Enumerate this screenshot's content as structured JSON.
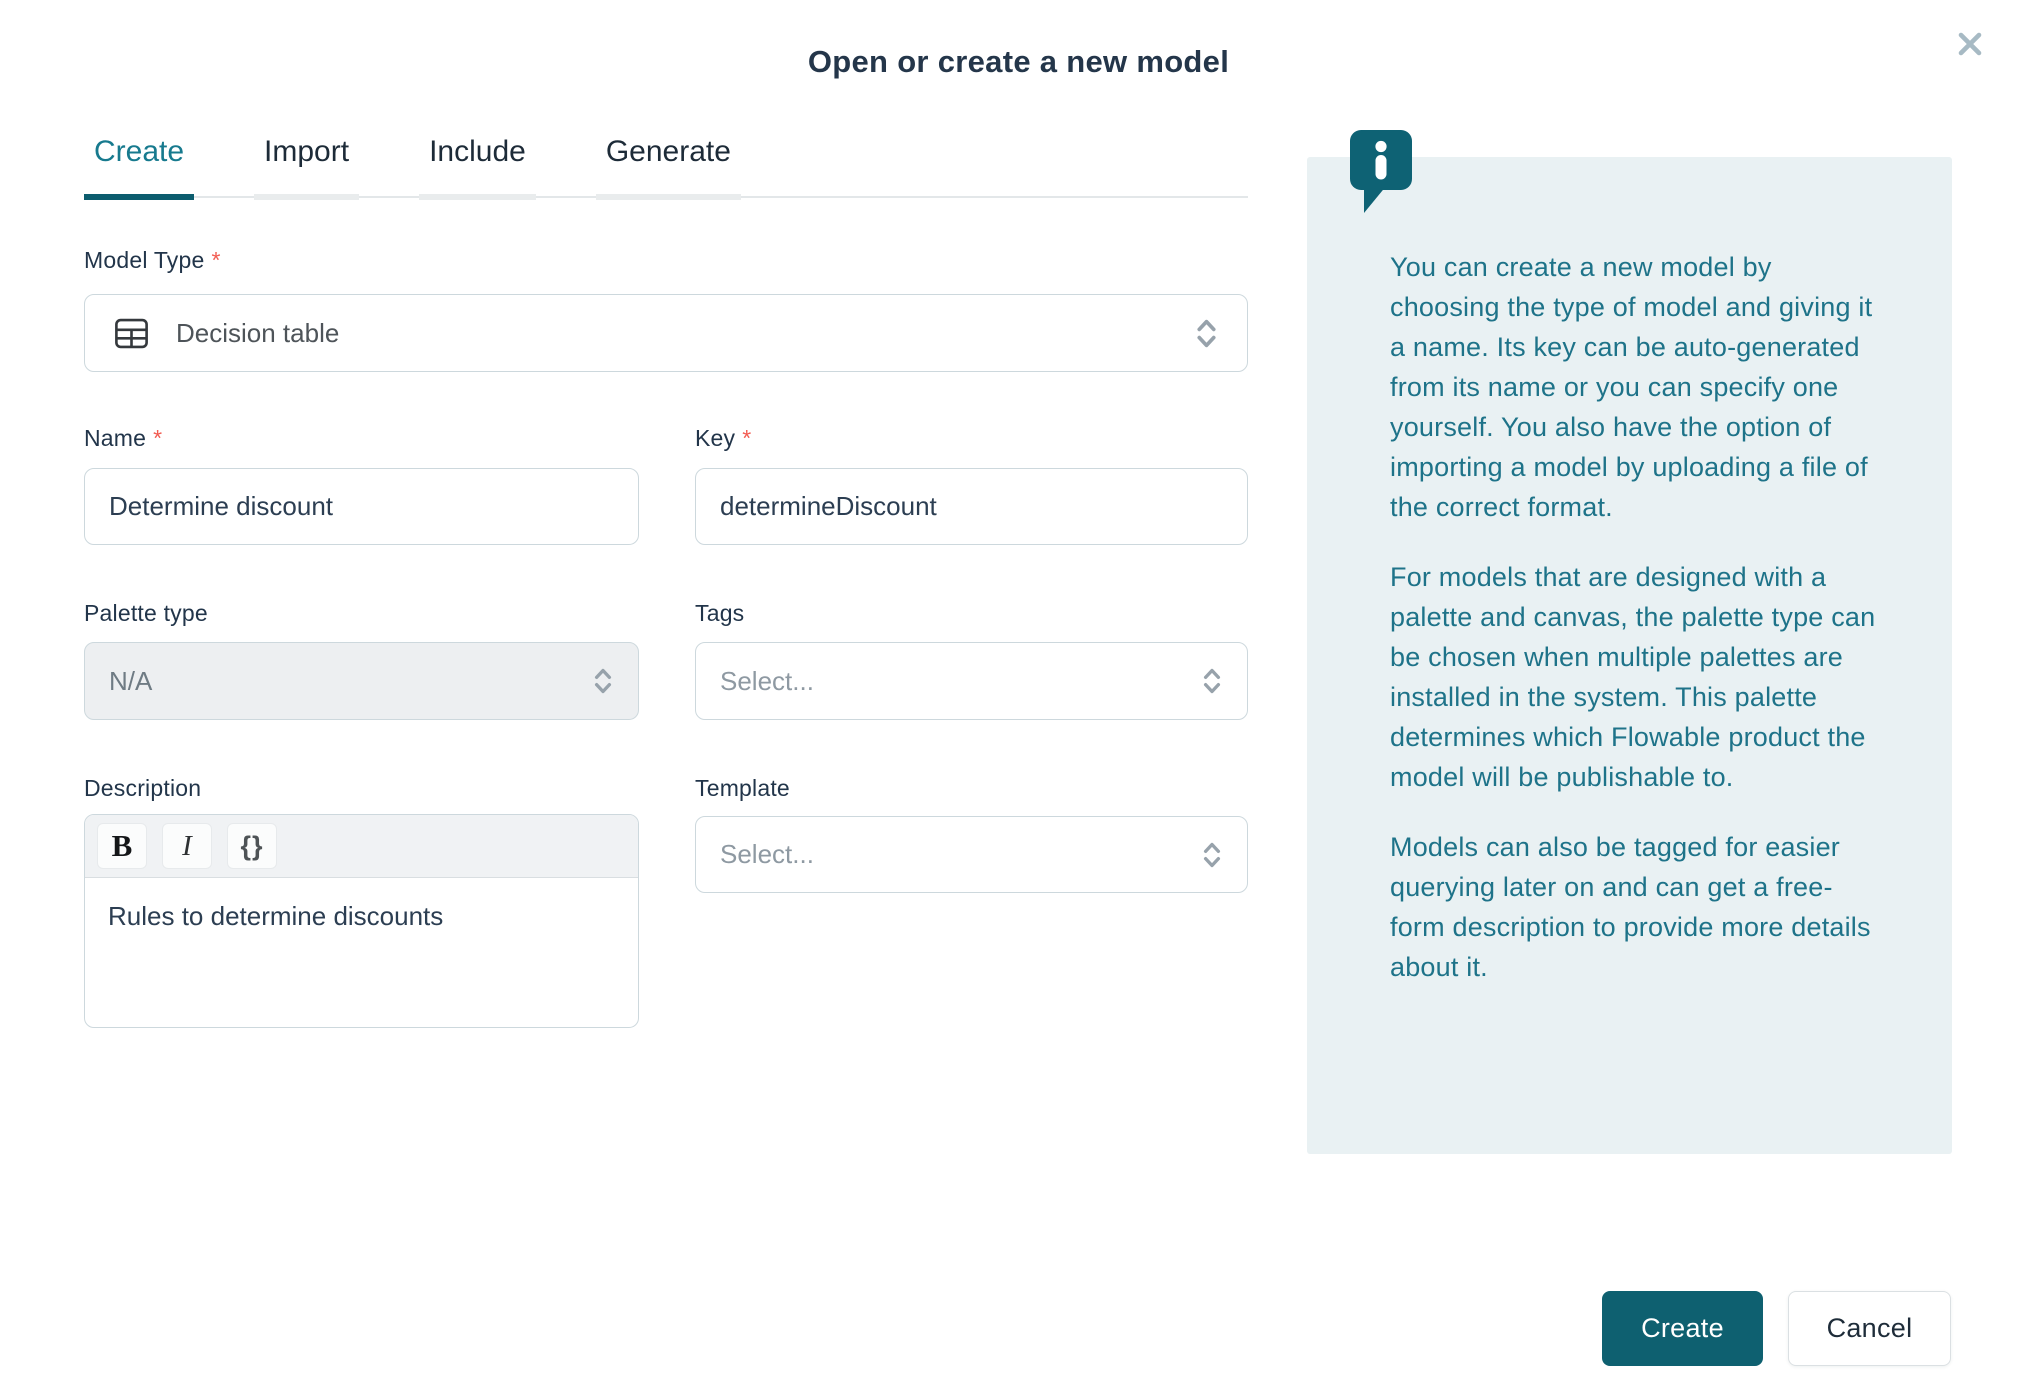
{
  "dialog": {
    "title": "Open or create a new model",
    "close_icon": "✕"
  },
  "tabs": {
    "items": [
      {
        "label": "Create",
        "active": true
      },
      {
        "label": "Import",
        "active": false
      },
      {
        "label": "Include",
        "active": false
      },
      {
        "label": "Generate",
        "active": false
      }
    ]
  },
  "form": {
    "required_marker": "*",
    "model_type": {
      "label": "Model Type",
      "required": true,
      "value": "Decision table",
      "icon": "decision-table-icon"
    },
    "name": {
      "label": "Name",
      "required": true,
      "value": "Determine discount"
    },
    "key": {
      "label": "Key",
      "required": true,
      "value": "determineDiscount"
    },
    "palette_type": {
      "label": "Palette type",
      "value": "N/A",
      "disabled": true
    },
    "tags": {
      "label": "Tags",
      "placeholder": "Select..."
    },
    "description": {
      "label": "Description",
      "value": "Rules to determine discounts",
      "toolbar": {
        "bold": "B",
        "italic": "I",
        "code": "{}"
      }
    },
    "template": {
      "label": "Template",
      "placeholder": "Select..."
    }
  },
  "info_panel": {
    "icon": "info-speech-bubble-icon",
    "paragraphs": [
      "You can create a new model by choosing the type of model and giving it a name. Its key can be auto-generated from its name or you can specify one yourself. You also have the option of importing a model by uploading a file of the correct format.",
      "For models that are designed with a palette and canvas, the palette type can be chosen when multiple palettes are installed in the system. This palette determines which Flowable product the model will be publishable to.",
      "Models can also be tagged for easier querying later on and can get a free-form description to provide more details about it."
    ]
  },
  "footer": {
    "create_label": "Create",
    "cancel_label": "Cancel"
  },
  "colors": {
    "accent_teal": "#0e6070",
    "active_tab_teal": "#177a8e",
    "info_text_teal": "#1e7389",
    "info_panel_bg": "#e9f1f3",
    "required_red": "#f25c52",
    "text_navy": "#22354a",
    "border_gray": "#cdd8dd"
  }
}
